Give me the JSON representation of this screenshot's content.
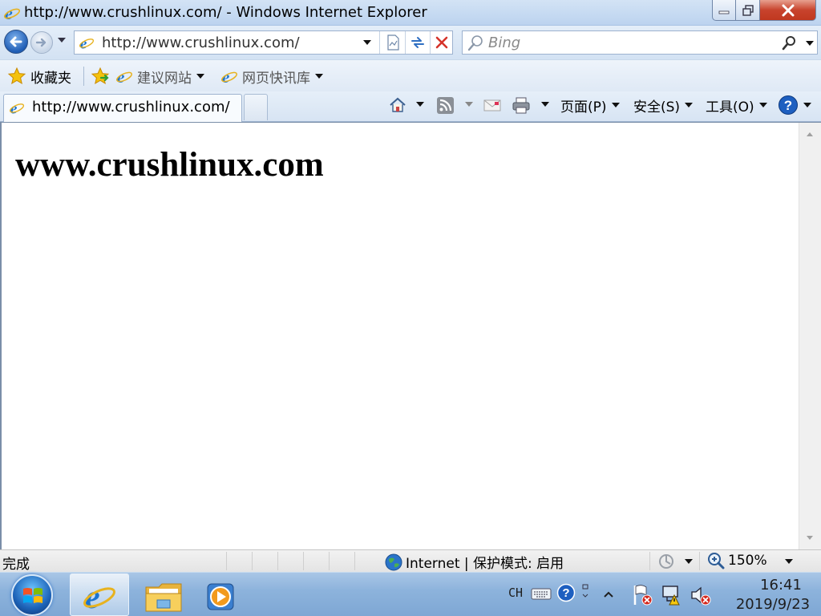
{
  "window": {
    "title": "http://www.crushlinux.com/ - Windows Internet Explorer"
  },
  "navigation": {
    "address": "http://www.crushlinux.com/",
    "search_placeholder": "Bing"
  },
  "favorites_bar": {
    "favorites_label": "收藏夹",
    "suggested_sites_label": "建议网站",
    "web_slice_gallery_label": "网页快讯库"
  },
  "tabs": [
    {
      "label": "http://www.crushlinux.com/"
    }
  ],
  "command_bar": {
    "page_label": "页面(P)",
    "safety_label": "安全(S)",
    "tools_label": "工具(O)"
  },
  "page": {
    "heading": "www.crushlinux.com"
  },
  "status_bar": {
    "status": "完成",
    "zone": "Internet | 保护模式: 启用",
    "zoom": "150%"
  },
  "taskbar": {
    "language": "CH",
    "time": "16:41",
    "date": "2019/9/23"
  },
  "colors": {
    "title_bar": "#c5d9f1",
    "close_button": "#c8432d",
    "taskbar": "#8db3dc",
    "back_button": "#1f5db5"
  },
  "icons": {
    "browser": "ie-icon",
    "back": "back-arrow-icon",
    "forward": "forward-arrow-icon",
    "compatibility": "compatibility-view-icon",
    "refresh": "refresh-icon",
    "stop": "stop-icon",
    "search": "magnifier-icon",
    "favorites": "star-icon",
    "add_favorites": "star-add-icon",
    "home": "home-icon",
    "feeds": "rss-icon",
    "mail": "mail-icon",
    "print": "printer-icon",
    "help": "help-icon"
  }
}
